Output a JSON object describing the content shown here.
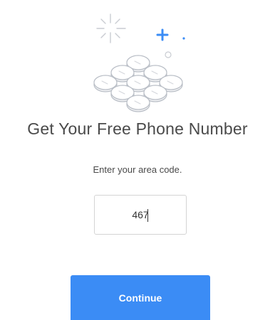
{
  "signup": {
    "title": "Get Your Free Phone Number",
    "instruction": "Enter your area code.",
    "area_code": {
      "value": "467",
      "placeholder": ""
    },
    "continue_label": "Continue"
  },
  "illustration": {
    "icon": "phone-keypad-icon",
    "sparkle_icon": "sparkle-icon",
    "plus_icon": "plus-icon"
  },
  "colors": {
    "accent": "#3b8cf5",
    "title_text": "#4a4a4a",
    "keypad_outline": "#b9bec6",
    "keypad_fill": "#f1f2f4"
  }
}
